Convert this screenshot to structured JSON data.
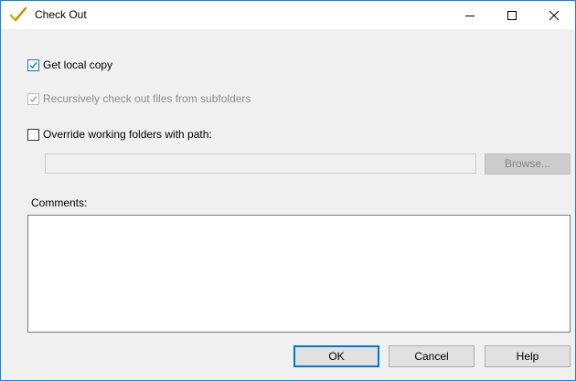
{
  "window": {
    "title": "Check Out",
    "title_icon": "checkmark-pencil-icon",
    "controls": {
      "minimize_icon": "minimize-icon",
      "maximize_icon": "maximize-icon",
      "close_icon": "close-icon"
    }
  },
  "options": {
    "get_local_copy": {
      "label": "Get local copy",
      "checked": true,
      "enabled": true
    },
    "recursive": {
      "label": "Recursively check out files from subfolders",
      "checked": true,
      "enabled": false
    },
    "override": {
      "label": "Override working folders with path:",
      "checked": false,
      "enabled": true
    }
  },
  "path": {
    "value": "",
    "enabled": false
  },
  "browse_label": "Browse...",
  "comments": {
    "label": "Comments:",
    "value": ""
  },
  "buttons": {
    "ok": "OK",
    "cancel": "Cancel",
    "help": "Help"
  },
  "colors": {
    "accent": "#0078d7",
    "icon_check": "#e8a317"
  }
}
